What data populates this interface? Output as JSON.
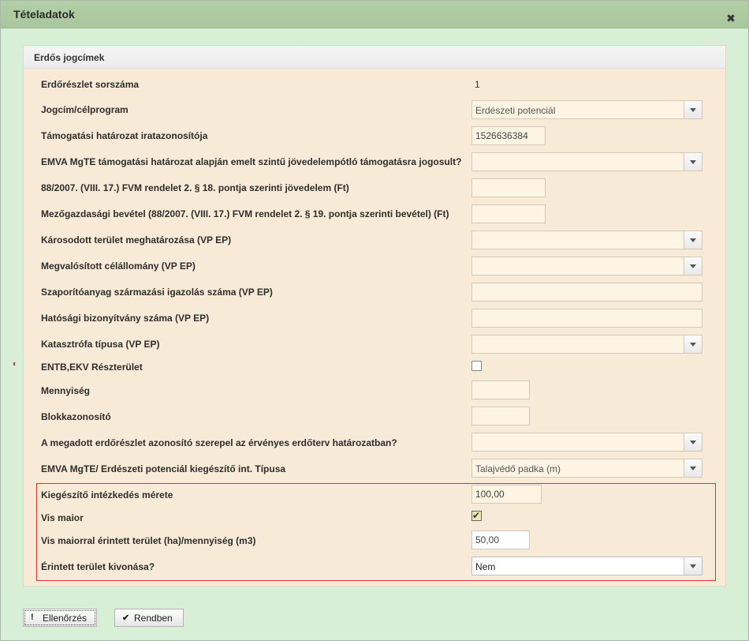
{
  "dialog": {
    "title": "Tételadatok"
  },
  "panel": {
    "title": "Erdős jogcímek"
  },
  "fields": [
    {
      "label": "Erdőrészlet sorszáma",
      "value": "1"
    },
    {
      "label": "Jogcím/célprogram",
      "value": "Erdészeti potenciál"
    },
    {
      "label": "Támogatási határozat iratazonosítója",
      "value": "1526636384"
    },
    {
      "label": "EMVA MgTE támogatási határozat alapján emelt szintű jövedelempótló támogatásra jogosult?",
      "value": ""
    },
    {
      "label": "88/2007. (VIII. 17.) FVM rendelet 2. § 18. pontja szerinti jövedelem (Ft)",
      "value": ""
    },
    {
      "label": "Mezőgazdasági bevétel (88/2007. (VIII. 17.) FVM rendelet 2. § 19. pontja szerinti bevétel) (Ft)",
      "value": ""
    },
    {
      "label": "Károsodott terület meghatározása (VP EP)",
      "value": ""
    },
    {
      "label": "Megvalósított célállomány (VP EP)",
      "value": ""
    },
    {
      "label": "Szaporítóanyag származási igazolás száma (VP EP)",
      "value": ""
    },
    {
      "label": "Hatósági bizonyítvány száma (VP EP)",
      "value": ""
    },
    {
      "label": "Katasztrófa típusa (VP EP)",
      "value": ""
    },
    {
      "label": "ENTB,EKV Részterület",
      "value": ""
    },
    {
      "label": "Mennyiség",
      "value": ""
    },
    {
      "label": "Blokkazonosító",
      "value": ""
    },
    {
      "label": "A megadott erdőrészlet azonosító szerepel az érvényes erdőterv határozatban?",
      "value": ""
    },
    {
      "label": "EMVA MgTE/ Erdészeti potenciál kiegészítő int. Típusa",
      "value": "Talajvédő padka (m)"
    },
    {
      "label": "Kiegészítő intézkedés mérete",
      "value": "100,00"
    },
    {
      "label": "Vis maior",
      "value": ""
    },
    {
      "label": "Vis maiorral érintett terület (ha)/mennyiség (m3)",
      "value": "50,00"
    },
    {
      "label": "Érintett terület kivonása?",
      "value": "Nem"
    }
  ],
  "buttons": {
    "check": "Ellenőrzés",
    "ok": "Rendben"
  }
}
